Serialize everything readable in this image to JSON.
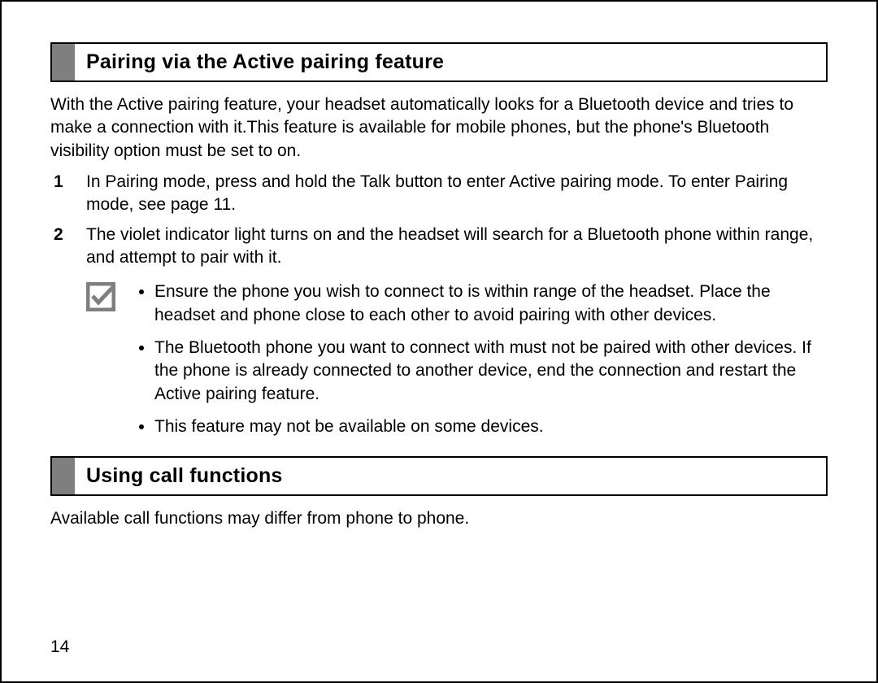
{
  "section1": {
    "title": "Pairing via the Active pairing feature",
    "intro": "With the Active pairing feature, your headset automatically looks for a Bluetooth device and tries to make a connection with it.This feature is available for mobile phones, but the phone's Bluetooth visibility option must be set to on.",
    "steps": [
      "In Pairing mode, press and hold the Talk button to enter Active pairing mode. To enter Pairing mode, see page 11.",
      "The violet indicator light turns on and the headset will search for a Bluetooth phone within range, and attempt to pair with it."
    ],
    "notes": [
      "Ensure the phone you wish to connect to is within range of the headset. Place the headset and phone close to each other to avoid pairing with other devices.",
      "The Bluetooth phone you want to connect with must not be paired with other devices. If the phone is already connected to another device, end the connection and restart the Active pairing feature.",
      "This feature may not be available on some devices."
    ]
  },
  "section2": {
    "title": "Using call functions",
    "intro": "Available call functions may differ from phone to phone."
  },
  "page_number": "14"
}
